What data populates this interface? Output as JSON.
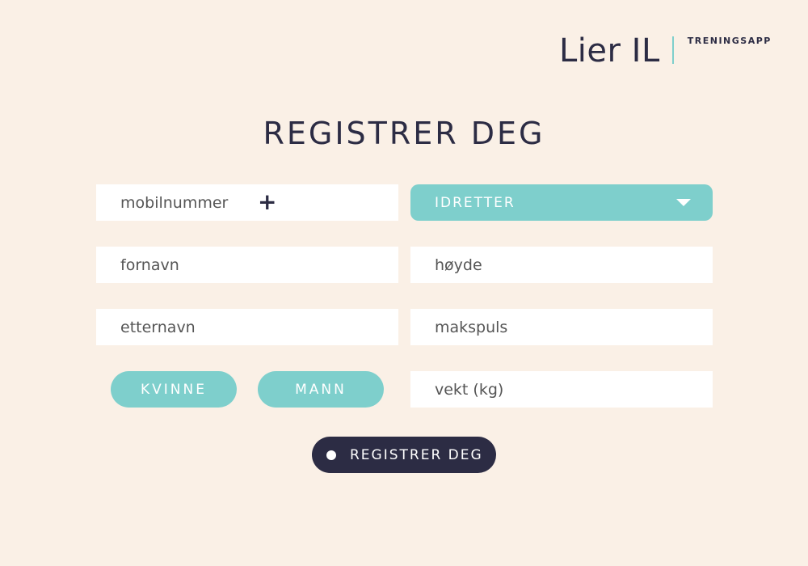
{
  "brand": {
    "name": "Lier IL",
    "tagline": "TRENINGSAPP"
  },
  "title": "REGISTRER DEG",
  "form": {
    "mobile": {
      "value": "",
      "placeholder": "mobilnummer",
      "action_icon": "plus-icon"
    },
    "sport_dropdown": {
      "selected": "IDRETTER",
      "icon": "chevron-down-icon"
    },
    "first_name": {
      "value": "",
      "placeholder": "fornavn"
    },
    "height": {
      "value": "",
      "placeholder": "høyde"
    },
    "last_name": {
      "value": "",
      "placeholder": "etternavn"
    },
    "max_pulse": {
      "value": "",
      "placeholder": "makspuls"
    },
    "weight": {
      "value": "",
      "placeholder": "vekt (kg)"
    },
    "gender": {
      "female_label": "KVINNE",
      "male_label": "MANN"
    },
    "submit_label": "REGISTRER DEG"
  },
  "colors": {
    "background": "#faf0e6",
    "accent": "#7ecfcc",
    "dark": "#2c2c44",
    "field": "#ffffff"
  }
}
